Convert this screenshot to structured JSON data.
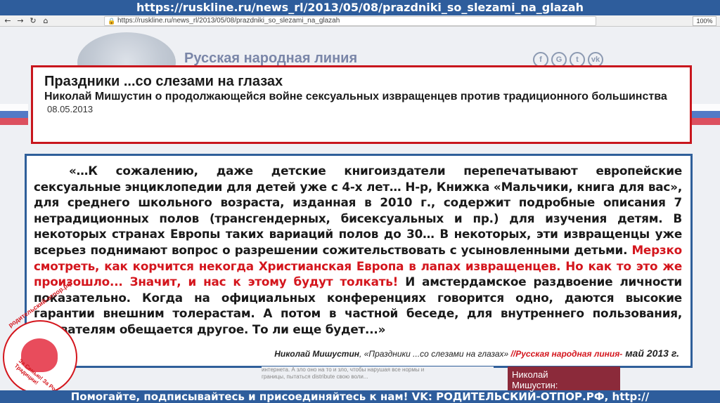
{
  "banner": {
    "url_title": "https://ruskline.ru/news_rl/2013/05/08/prazdniki_so_slezami_na_glazah"
  },
  "browser": {
    "url": "https://ruskline.ru/news_rl/2013/05/08/prazdniki_so_slezami_na_glazah",
    "back_icon": "back-arrow-icon",
    "forward_icon": "forward-arrow-icon",
    "reload_icon": "reload-icon",
    "home_icon": "home-icon",
    "zoom": "100%"
  },
  "site": {
    "name": "Русская народная линия",
    "social": [
      "f",
      "G",
      "t",
      "vk"
    ]
  },
  "article": {
    "title": "Праздники ...со слезами на глазах",
    "subtitle": "Николай Мишустин о продолжающейся войне сексуальных извращенцев против традиционного большинства",
    "date": "08.05.2013"
  },
  "quote": {
    "part1": "«…К сожалению, даже детские книгоиздатели перепечатывают европейские сексуальные энциклопедии для детей уже с 4-х лет… Н-р, Книжка «Мальчики, книга для вас», для среднего школьного возраста, изданная в 2010 г., содержит подробные описания 7 нетрадиционных полов (трансгендерных, бисексуальных и пр.) для изучения детям. В некоторых странах Европы таких вариаций полов до 30… В некоторых, эти извращенцы уже всерьез поднимают вопрос о разрешении сожительствовать с усыновленными детьми. ",
    "red": "Мерзко смотреть, как корчится некогда Христианская Европа в лапах извращенцев. Но как то это же произошло... Значит, и нас к этому будут толкать!",
    "part2": " И амстердамское раздвоение личности показательно. Когда на официальных конференциях говорится одно, даются высокие гарантии внешним толерастам. А потом в частной беседе, для внутреннего пользования, обывателям обещается другое. То ли еще будет...»"
  },
  "attribution": {
    "author": "Николай Мишустин",
    "work": ", «Праздники ...со слезами на глазах» ",
    "source": "//Русская народная линия-",
    "date": " май 2013 г."
  },
  "sticker": {
    "top_text": "родительский-отпор.рф",
    "bottom_text": "За Семью! За Родину! За Традиции!"
  },
  "ghost": {
    "line1": "интернета. А зло оно на то и зло, чтобы нарушая все нормы и",
    "line2": "границы, пытаться distribute свою воли..."
  },
  "side_panel": {
    "line1": "Николай",
    "line2": "Мишустин:"
  },
  "footer": {
    "text": "Помогайте, подписывайтесь и присоединяйтесь к нам! VK: РОДИТЕЛЬСКИЙ-ОТПОР.РФ, http://родительскийотпор.рф"
  },
  "colors": {
    "accent_red": "#d4161d",
    "brand_blue": "#2e5d9c"
  }
}
